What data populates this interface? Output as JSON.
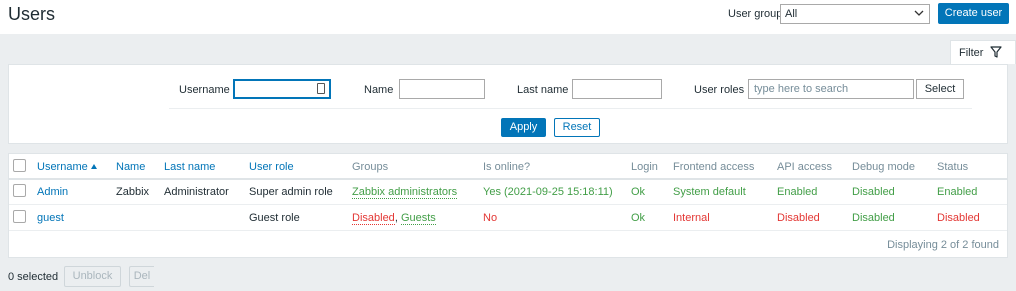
{
  "header": {
    "title": "Users",
    "user_group_label": "User group",
    "user_group_value": "All",
    "create_button": "Create user"
  },
  "filter": {
    "tab_label": "Filter",
    "username_label": "Username",
    "username_value": "",
    "name_label": "Name",
    "name_value": "",
    "lastname_label": "Last name",
    "lastname_value": "",
    "roles_label": "User roles",
    "roles_placeholder": "type here to search",
    "select_button": "Select",
    "apply_button": "Apply",
    "reset_button": "Reset"
  },
  "table": {
    "columns": {
      "username": "Username",
      "name": "Name",
      "last_name": "Last name",
      "user_role": "User role",
      "groups": "Groups",
      "online": "Is online?",
      "login": "Login",
      "frontend": "Frontend access",
      "api": "API access",
      "debug": "Debug mode",
      "status": "Status"
    },
    "rows": [
      {
        "username": "Admin",
        "name": "Zabbix",
        "last_name": "Administrator",
        "user_role": "Super admin role",
        "groups": [
          "Zabbix administrators"
        ],
        "online": "Yes (2021-09-25 15:18:11)",
        "login": "Ok",
        "frontend": "System default",
        "api": "Enabled",
        "debug": "Disabled",
        "status": "Enabled"
      },
      {
        "username": "guest",
        "name": "",
        "last_name": "",
        "user_role": "Guest role",
        "groups": [
          "Disabled",
          "Guests"
        ],
        "groups_separator": ", ",
        "online": "No",
        "login": "Ok",
        "frontend": "Internal",
        "api": "Disabled",
        "debug": "Disabled",
        "status": "Disabled"
      }
    ],
    "footer": "Displaying 2 of 2 found"
  },
  "actions": {
    "selected_count": "0 selected",
    "unblock_button": "Unblock",
    "delete_button_visible_text": "Del"
  },
  "colors": {
    "accent": "#0275b8",
    "ok_green": "#429e47",
    "error_red": "#e33734",
    "page_bg": "#ebeef0"
  }
}
